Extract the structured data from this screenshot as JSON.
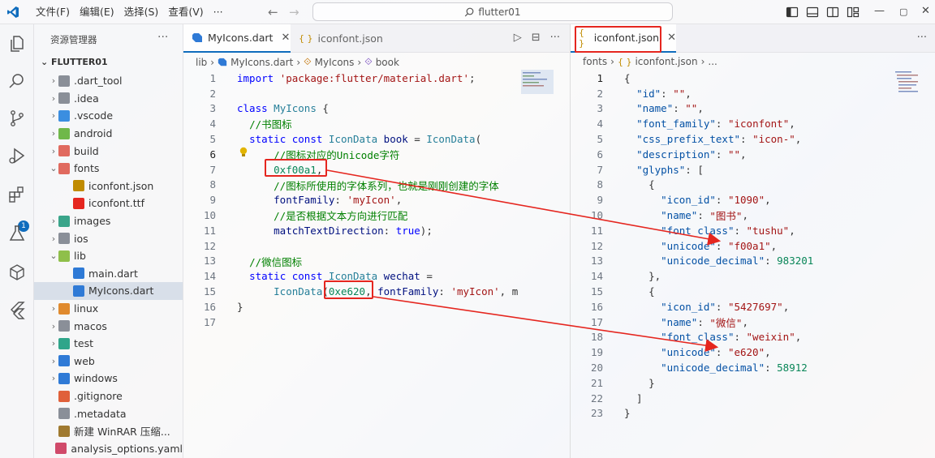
{
  "menu": [
    "文件(F)",
    "编辑(E)",
    "选择(S)",
    "查看(V)",
    "···"
  ],
  "command_center": "flutter01",
  "explorer": {
    "title": "资源管理器",
    "more": "···",
    "root": "FLUTTER01",
    "items": [
      {
        "label": ".dart_tool",
        "chev": "›",
        "color": "#8a8f98"
      },
      {
        "label": ".idea",
        "chev": "›",
        "color": "#8a8f98"
      },
      {
        "label": ".vscode",
        "chev": "›",
        "color": "#3b8ee0"
      },
      {
        "label": "android",
        "chev": "›",
        "color": "#6fb84a"
      },
      {
        "label": "build",
        "chev": "›",
        "color": "#e06a5f"
      },
      {
        "label": "fonts",
        "chev": "⌄",
        "color": "#e06a5f"
      },
      {
        "label": "iconfont.json",
        "chev": "",
        "color": "#c08b00"
      },
      {
        "label": "iconfont.ttf",
        "chev": "",
        "color": "#e5261f"
      },
      {
        "label": "images",
        "chev": "›",
        "color": "#3aa58a"
      },
      {
        "label": "ios",
        "chev": "›",
        "color": "#8a8f98"
      },
      {
        "label": "lib",
        "chev": "⌄",
        "color": "#8fbf4a"
      },
      {
        "label": "main.dart",
        "chev": "",
        "color": "#2f7ad6"
      },
      {
        "label": "MyIcons.dart",
        "chev": "",
        "color": "#2f7ad6"
      },
      {
        "label": "linux",
        "chev": "›",
        "color": "#e08a2e"
      },
      {
        "label": "macos",
        "chev": "›",
        "color": "#8a8f98"
      },
      {
        "label": "test",
        "chev": "›",
        "color": "#2fa58a"
      },
      {
        "label": "web",
        "chev": "›",
        "color": "#2f7ad6"
      },
      {
        "label": "windows",
        "chev": "›",
        "color": "#2f7ad6"
      },
      {
        "label": ".gitignore",
        "chev": "",
        "color": "#e0603a"
      },
      {
        "label": ".metadata",
        "chev": "",
        "color": "#8a8f98"
      },
      {
        "label": "新建 WinRAR 压缩...",
        "chev": "",
        "color": "#a07a30"
      },
      {
        "label": "analysis_options.yaml",
        "chev": "",
        "color": "#d04a6a"
      }
    ]
  },
  "editor1": {
    "tab_active": "MyIcons.dart",
    "tab_inactive": "iconfont.json",
    "breadcrumb": [
      "lib",
      "MyIcons.dart",
      "MyIcons",
      "book"
    ],
    "lines": [
      {
        "n": "1",
        "toks": [
          [
            "k",
            "import"
          ],
          [
            "pl",
            " "
          ],
          [
            "s",
            "'package:flutter/material.dart'"
          ],
          [
            "pl",
            ";"
          ]
        ]
      },
      {
        "n": "2",
        "toks": []
      },
      {
        "n": "3",
        "toks": [
          [
            "k",
            "class"
          ],
          [
            "pl",
            " "
          ],
          [
            "t",
            "MyIcons"
          ],
          [
            "pl",
            " {"
          ]
        ]
      },
      {
        "n": "4",
        "toks": [
          [
            "pl",
            "  "
          ],
          [
            "c",
            "//书图标"
          ]
        ]
      },
      {
        "n": "5",
        "toks": [
          [
            "pl",
            "  "
          ],
          [
            "k",
            "static"
          ],
          [
            "pl",
            " "
          ],
          [
            "k",
            "const"
          ],
          [
            "pl",
            " "
          ],
          [
            "t",
            "IconData"
          ],
          [
            "pl",
            " "
          ],
          [
            "p",
            "book"
          ],
          [
            "pl",
            " = "
          ],
          [
            "t",
            "IconData"
          ],
          [
            "pl",
            "("
          ]
        ]
      },
      {
        "n": "6",
        "toks": [
          [
            "pl",
            "      "
          ],
          [
            "c",
            "//图标对应的Unicode字符"
          ]
        ]
      },
      {
        "n": "7",
        "toks": [
          [
            "pl",
            "      "
          ],
          [
            "n",
            "0xf00a1"
          ],
          [
            "pl",
            ","
          ]
        ]
      },
      {
        "n": "8",
        "toks": [
          [
            "pl",
            "      "
          ],
          [
            "c",
            "//图标所使用的字体系列，也就是刚刚创建的字体"
          ]
        ]
      },
      {
        "n": "9",
        "toks": [
          [
            "pl",
            "      "
          ],
          [
            "p",
            "fontFamily"
          ],
          [
            "pl",
            ": "
          ],
          [
            "s",
            "'myIcon'"
          ],
          [
            "pl",
            ","
          ]
        ]
      },
      {
        "n": "10",
        "toks": [
          [
            "pl",
            "      "
          ],
          [
            "c",
            "//是否根据文本方向进行匹配"
          ]
        ]
      },
      {
        "n": "11",
        "toks": [
          [
            "pl",
            "      "
          ],
          [
            "p",
            "matchTextDirection"
          ],
          [
            "pl",
            ": "
          ],
          [
            "k",
            "true"
          ],
          [
            "pl",
            ");"
          ]
        ]
      },
      {
        "n": "12",
        "toks": []
      },
      {
        "n": "13",
        "toks": [
          [
            "pl",
            "  "
          ],
          [
            "c",
            "//微信图标"
          ]
        ]
      },
      {
        "n": "14",
        "toks": [
          [
            "pl",
            "  "
          ],
          [
            "k",
            "static"
          ],
          [
            "pl",
            " "
          ],
          [
            "k",
            "const"
          ],
          [
            "pl",
            " "
          ],
          [
            "t",
            "IconData"
          ],
          [
            "pl",
            " "
          ],
          [
            "p",
            "wechat"
          ],
          [
            "pl",
            " ="
          ]
        ]
      },
      {
        "n": "15",
        "toks": [
          [
            "pl",
            "      "
          ],
          [
            "t",
            "IconData"
          ],
          [
            "pl",
            "("
          ],
          [
            "n",
            "0xe620"
          ],
          [
            "pl",
            ", "
          ],
          [
            "p",
            "fontFamily"
          ],
          [
            "pl",
            ": "
          ],
          [
            "s",
            "'myIcon'"
          ],
          [
            "pl",
            ", m"
          ]
        ]
      },
      {
        "n": "16",
        "toks": [
          [
            "pl",
            "}"
          ]
        ]
      },
      {
        "n": "17",
        "toks": []
      }
    ]
  },
  "editor2": {
    "tab_active": "iconfont.json",
    "breadcrumb": [
      "fonts",
      "iconfont.json",
      "..."
    ],
    "lines": [
      {
        "n": "1",
        "toks": [
          [
            "pl",
            "{"
          ]
        ]
      },
      {
        "n": "2",
        "toks": [
          [
            "pl",
            "  "
          ],
          [
            "js-key",
            "\"id\""
          ],
          [
            "pl",
            ": "
          ],
          [
            "js-str",
            "\"\""
          ],
          [
            "pl",
            ","
          ]
        ]
      },
      {
        "n": "3",
        "toks": [
          [
            "pl",
            "  "
          ],
          [
            "js-key",
            "\"name\""
          ],
          [
            "pl",
            ": "
          ],
          [
            "js-str",
            "\"\""
          ],
          [
            "pl",
            ","
          ]
        ]
      },
      {
        "n": "4",
        "toks": [
          [
            "pl",
            "  "
          ],
          [
            "js-key",
            "\"font_family\""
          ],
          [
            "pl",
            ": "
          ],
          [
            "js-str",
            "\"iconfont\""
          ],
          [
            "pl",
            ","
          ]
        ]
      },
      {
        "n": "5",
        "toks": [
          [
            "pl",
            "  "
          ],
          [
            "js-key",
            "\"css_prefix_text\""
          ],
          [
            "pl",
            ": "
          ],
          [
            "js-str",
            "\"icon-\""
          ],
          [
            "pl",
            ","
          ]
        ]
      },
      {
        "n": "6",
        "toks": [
          [
            "pl",
            "  "
          ],
          [
            "js-key",
            "\"description\""
          ],
          [
            "pl",
            ": "
          ],
          [
            "js-str",
            "\"\""
          ],
          [
            "pl",
            ","
          ]
        ]
      },
      {
        "n": "7",
        "toks": [
          [
            "pl",
            "  "
          ],
          [
            "js-key",
            "\"glyphs\""
          ],
          [
            "pl",
            ": ["
          ]
        ]
      },
      {
        "n": "8",
        "toks": [
          [
            "pl",
            "    {"
          ]
        ]
      },
      {
        "n": "9",
        "toks": [
          [
            "pl",
            "      "
          ],
          [
            "js-key",
            "\"icon_id\""
          ],
          [
            "pl",
            ": "
          ],
          [
            "js-str",
            "\"1090\""
          ],
          [
            "pl",
            ","
          ]
        ]
      },
      {
        "n": "10",
        "toks": [
          [
            "pl",
            "      "
          ],
          [
            "js-key",
            "\"name\""
          ],
          [
            "pl",
            ": "
          ],
          [
            "js-str",
            "\"图书\""
          ],
          [
            "pl",
            ","
          ]
        ]
      },
      {
        "n": "11",
        "toks": [
          [
            "pl",
            "      "
          ],
          [
            "js-key",
            "\"font_class\""
          ],
          [
            "pl",
            ": "
          ],
          [
            "js-str",
            "\"tushu\""
          ],
          [
            "pl",
            ","
          ]
        ]
      },
      {
        "n": "12",
        "toks": [
          [
            "pl",
            "      "
          ],
          [
            "js-key",
            "\"unicode\""
          ],
          [
            "pl",
            ": "
          ],
          [
            "js-str",
            "\"f00a1\""
          ],
          [
            "pl",
            ","
          ]
        ]
      },
      {
        "n": "13",
        "toks": [
          [
            "pl",
            "      "
          ],
          [
            "js-key",
            "\"unicode_decimal\""
          ],
          [
            "pl",
            ": "
          ],
          [
            "js-num",
            "983201"
          ]
        ]
      },
      {
        "n": "14",
        "toks": [
          [
            "pl",
            "    },"
          ]
        ]
      },
      {
        "n": "15",
        "toks": [
          [
            "pl",
            "    {"
          ]
        ]
      },
      {
        "n": "16",
        "toks": [
          [
            "pl",
            "      "
          ],
          [
            "js-key",
            "\"icon_id\""
          ],
          [
            "pl",
            ": "
          ],
          [
            "js-str",
            "\"5427697\""
          ],
          [
            "pl",
            ","
          ]
        ]
      },
      {
        "n": "17",
        "toks": [
          [
            "pl",
            "      "
          ],
          [
            "js-key",
            "\"name\""
          ],
          [
            "pl",
            ": "
          ],
          [
            "js-str",
            "\"微信\""
          ],
          [
            "pl",
            ","
          ]
        ]
      },
      {
        "n": "18",
        "toks": [
          [
            "pl",
            "      "
          ],
          [
            "js-key",
            "\"font_class\""
          ],
          [
            "pl",
            ": "
          ],
          [
            "js-str",
            "\"weixin\""
          ],
          [
            "pl",
            ","
          ]
        ]
      },
      {
        "n": "19",
        "toks": [
          [
            "pl",
            "      "
          ],
          [
            "js-key",
            "\"unicode\""
          ],
          [
            "pl",
            ": "
          ],
          [
            "js-str",
            "\"e620\""
          ],
          [
            "pl",
            ","
          ]
        ]
      },
      {
        "n": "20",
        "toks": [
          [
            "pl",
            "      "
          ],
          [
            "js-key",
            "\"unicode_decimal\""
          ],
          [
            "pl",
            ": "
          ],
          [
            "js-num",
            "58912"
          ]
        ]
      },
      {
        "n": "21",
        "toks": [
          [
            "pl",
            "    }"
          ]
        ]
      },
      {
        "n": "22",
        "toks": [
          [
            "pl",
            "  ]"
          ]
        ]
      },
      {
        "n": "23",
        "toks": [
          [
            "pl",
            "}"
          ]
        ]
      }
    ]
  },
  "colors": {
    "accent": "#0f6cbd",
    "annotation": "#e5261f"
  }
}
